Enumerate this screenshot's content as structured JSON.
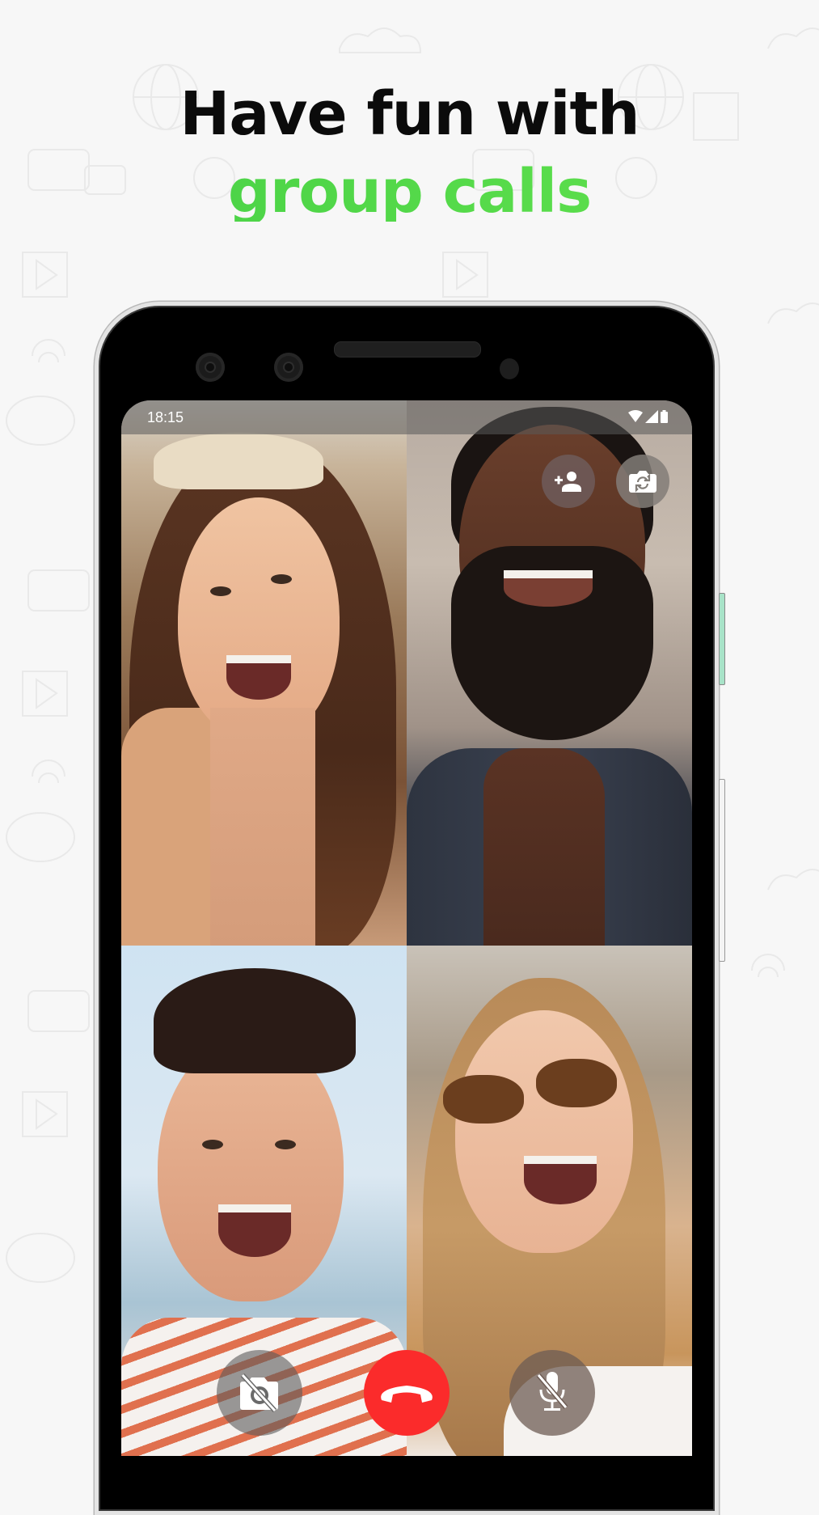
{
  "headline": {
    "line1": "Have fun with",
    "line2": "group calls"
  },
  "colors": {
    "accent_green": "#4bd54a",
    "end_call_red": "#fb2b2b",
    "background": "#f7f7f7"
  },
  "status_bar": {
    "time": "18:15",
    "icons": [
      "wifi-icon",
      "signal-icon",
      "battery-icon"
    ]
  },
  "call": {
    "participants": [
      {
        "tile": "top-left",
        "description": "woman with headband smiling"
      },
      {
        "tile": "top-right",
        "description": "bearded man laughing"
      },
      {
        "tile": "bottom-left",
        "description": "man in striped shirt laughing"
      },
      {
        "tile": "bottom-right",
        "description": "woman with sunglasses laughing"
      }
    ],
    "top_controls": [
      {
        "name": "add-participant-button",
        "icon": "person-add-icon"
      },
      {
        "name": "switch-camera-button",
        "icon": "camera-switch-icon"
      }
    ],
    "bottom_controls": [
      {
        "name": "camera-off-button",
        "icon": "camera-off-icon"
      },
      {
        "name": "end-call-button",
        "icon": "phone-hangup-icon"
      },
      {
        "name": "mute-mic-button",
        "icon": "mic-off-icon"
      }
    ]
  }
}
